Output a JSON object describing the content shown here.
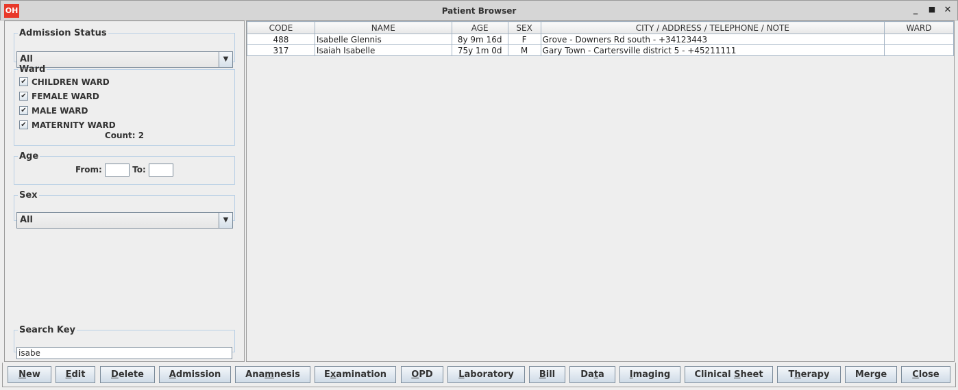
{
  "window": {
    "title": "Patient Browser",
    "logo": "OH",
    "controls": [
      "minimize-icon",
      "maximize-icon",
      "close-icon"
    ]
  },
  "filters": {
    "admission_status": {
      "label": "Admission Status",
      "value": "All"
    },
    "ward": {
      "label": "Ward",
      "items": [
        {
          "label": "CHILDREN WARD",
          "checked": true
        },
        {
          "label": "FEMALE WARD",
          "checked": true
        },
        {
          "label": "MALE WARD",
          "checked": true
        },
        {
          "label": "MATERNITY WARD",
          "checked": true
        }
      ],
      "count": "Count: 2"
    },
    "age": {
      "label": "Age",
      "from_label": "From:",
      "from_value": "",
      "to_label": "To:",
      "to_value": ""
    },
    "sex": {
      "label": "Sex",
      "value": "All"
    },
    "search": {
      "label": "Search Key",
      "value": "isabe"
    }
  },
  "table": {
    "columns": [
      "CODE",
      "NAME",
      "AGE",
      "SEX",
      "CITY / ADDRESS / TELEPHONE / NOTE",
      "WARD"
    ],
    "rows": [
      [
        "488",
        "Isabelle Glennis",
        "8y 9m 16d",
        "F",
        "Grove - Downers Rd south - +34123443",
        ""
      ],
      [
        "317",
        "Isaiah Isabelle",
        "75y 1m 0d",
        "M",
        "Gary Town - Cartersville district 5 - +45211111",
        ""
      ]
    ]
  },
  "buttons": [
    {
      "pre": "",
      "key": "N",
      "post": "ew"
    },
    {
      "pre": "",
      "key": "E",
      "post": "dit"
    },
    {
      "pre": "",
      "key": "D",
      "post": "elete"
    },
    {
      "pre": "",
      "key": "A",
      "post": "dmission"
    },
    {
      "pre": "Ana",
      "key": "m",
      "post": "nesis"
    },
    {
      "pre": "E",
      "key": "x",
      "post": "amination"
    },
    {
      "pre": "",
      "key": "O",
      "post": "PD"
    },
    {
      "pre": "",
      "key": "L",
      "post": "aboratory"
    },
    {
      "pre": "",
      "key": "B",
      "post": "ill"
    },
    {
      "pre": "Da",
      "key": "t",
      "post": "a"
    },
    {
      "pre": "",
      "key": "I",
      "post": "maging"
    },
    {
      "pre": "Clinical ",
      "key": "S",
      "post": "heet"
    },
    {
      "pre": "T",
      "key": "h",
      "post": "erapy"
    },
    {
      "pre": "Mer",
      "key": "g",
      "post": "e"
    },
    {
      "pre": "",
      "key": "C",
      "post": "lose"
    }
  ]
}
